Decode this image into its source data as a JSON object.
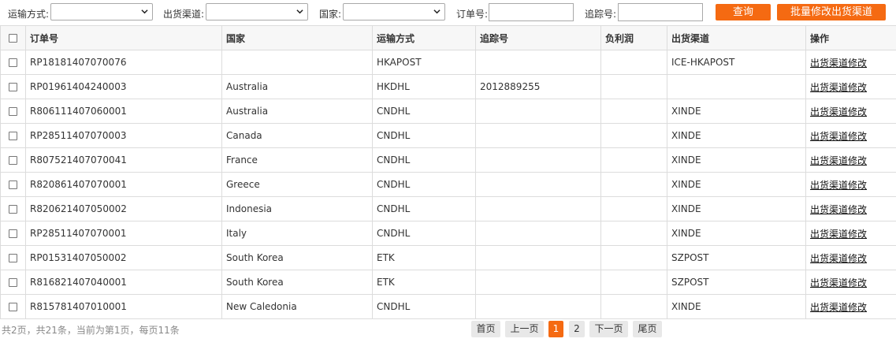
{
  "filters": {
    "shipping_method_label": "运输方式:",
    "channel_label": "出货渠道:",
    "country_label": "国家:",
    "order_no_label": "订单号:",
    "tracking_no_label": "追踪号:",
    "order_no_value": "",
    "tracking_no_value": "",
    "search_button": "查询",
    "batch_modify_button": "批量修改出货渠道"
  },
  "table": {
    "columns": [
      "订单号",
      "国家",
      "运输方式",
      "追踪号",
      "负利润",
      "出货渠道",
      "操作"
    ],
    "rows": [
      {
        "order": "RP18181407070076",
        "country": "",
        "method": "HKAPOST",
        "tracking": "",
        "profit": "",
        "channel": "ICE-HKAPOST",
        "action": "出货渠道修改"
      },
      {
        "order": "RP01961404240003",
        "country": "Australia",
        "method": "HKDHL",
        "tracking": "2012889255",
        "profit": "",
        "channel": "",
        "action": "出货渠道修改"
      },
      {
        "order": "R806111407060001",
        "country": "Australia",
        "method": "CNDHL",
        "tracking": "",
        "profit": "",
        "channel": "XINDE",
        "action": "出货渠道修改"
      },
      {
        "order": "RP28511407070003",
        "country": "Canada",
        "method": "CNDHL",
        "tracking": "",
        "profit": "",
        "channel": "XINDE",
        "action": "出货渠道修改"
      },
      {
        "order": "R807521407070041",
        "country": "France",
        "method": "CNDHL",
        "tracking": "",
        "profit": "",
        "channel": "XINDE",
        "action": "出货渠道修改"
      },
      {
        "order": "R820861407070001",
        "country": "Greece",
        "method": "CNDHL",
        "tracking": "",
        "profit": "",
        "channel": "XINDE",
        "action": "出货渠道修改"
      },
      {
        "order": "R820621407050002",
        "country": "Indonesia",
        "method": "CNDHL",
        "tracking": "",
        "profit": "",
        "channel": "XINDE",
        "action": "出货渠道修改"
      },
      {
        "order": "RP28511407070001",
        "country": "Italy",
        "method": "CNDHL",
        "tracking": "",
        "profit": "",
        "channel": "XINDE",
        "action": "出货渠道修改"
      },
      {
        "order": "RP01531407050002",
        "country": "South Korea",
        "method": "ETK",
        "tracking": "",
        "profit": "",
        "channel": "SZPOST",
        "action": "出货渠道修改"
      },
      {
        "order": "R816821407040001",
        "country": "South Korea",
        "method": "ETK",
        "tracking": "",
        "profit": "",
        "channel": "SZPOST",
        "action": "出货渠道修改"
      },
      {
        "order": "R815781407010001",
        "country": "New Caledonia",
        "method": "CNDHL",
        "tracking": "",
        "profit": "",
        "channel": "XINDE",
        "action": "出货渠道修改"
      }
    ]
  },
  "footer": {
    "summary": "共2页，共21条，当前为第1页，每页11条",
    "first": "首页",
    "prev": "上一页",
    "pages": [
      "1",
      "2"
    ],
    "current_page": "1",
    "next": "下一页",
    "last": "尾页"
  },
  "colors": {
    "accent": "#f56a12",
    "header_bg": "#f7f7f7",
    "border": "#dcdcdc"
  },
  "icons": {
    "select_caret": "chevron-down-icon"
  }
}
